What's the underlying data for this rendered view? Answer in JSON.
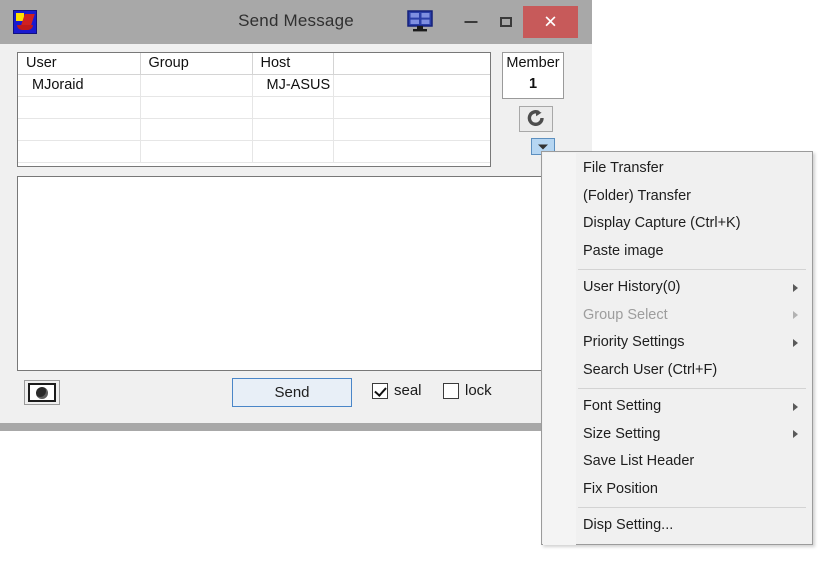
{
  "window": {
    "title": "Send Message",
    "icon": "ipmsg-app-icon",
    "title_bar_bg": "#a8a8a8",
    "close_button_bg": "#c75a5a",
    "controls": {
      "monitor": "monitor-icon",
      "minimize": "–",
      "maximize": "□",
      "close": "✕"
    }
  },
  "user_list": {
    "columns": [
      "User",
      "Group",
      "Host",
      ""
    ],
    "rows": [
      {
        "user": "MJoraid",
        "group": "",
        "host": "MJ-ASUS",
        "extra": ""
      },
      {
        "user": "",
        "group": "",
        "host": "",
        "extra": ""
      },
      {
        "user": "",
        "group": "",
        "host": "",
        "extra": ""
      },
      {
        "user": "",
        "group": "",
        "host": "",
        "extra": ""
      }
    ]
  },
  "member_panel": {
    "label": "Member",
    "count": "1",
    "refresh_icon": "refresh-icon",
    "dropdown_icon": "chevron-down-icon",
    "dropdown_highlight": "#b6d6f2"
  },
  "message": {
    "value": "",
    "placeholder": ""
  },
  "bottom_bar": {
    "capture_icon": "camera-icon",
    "send_label": "Send",
    "send_accent": "#4a86c8",
    "seal_label": "seal",
    "seal_checked": true,
    "lock_label": "lock",
    "lock_checked": false
  },
  "context_menu": {
    "items": [
      {
        "label": "File Transfer",
        "submenu": false,
        "disabled": false,
        "separator_after": false
      },
      {
        "label": "(Folder) Transfer",
        "submenu": false,
        "disabled": false,
        "separator_after": false
      },
      {
        "label": "Display Capture (Ctrl+K)",
        "submenu": false,
        "disabled": false,
        "separator_after": false
      },
      {
        "label": "Paste image",
        "submenu": false,
        "disabled": false,
        "separator_after": true
      },
      {
        "label": "User History(0)",
        "submenu": true,
        "disabled": false,
        "separator_after": false
      },
      {
        "label": "Group Select",
        "submenu": true,
        "disabled": true,
        "separator_after": false
      },
      {
        "label": "Priority Settings",
        "submenu": true,
        "disabled": false,
        "separator_after": false
      },
      {
        "label": "Search User (Ctrl+F)",
        "submenu": false,
        "disabled": false,
        "separator_after": true
      },
      {
        "label": "Font Setting",
        "submenu": true,
        "disabled": false,
        "separator_after": false
      },
      {
        "label": "Size Setting",
        "submenu": true,
        "disabled": false,
        "separator_after": false
      },
      {
        "label": "Save List Header",
        "submenu": false,
        "disabled": false,
        "separator_after": false
      },
      {
        "label": "Fix Position",
        "submenu": false,
        "disabled": false,
        "separator_after": true
      },
      {
        "label": "Disp Setting...",
        "submenu": false,
        "disabled": false,
        "separator_after": false
      }
    ]
  }
}
